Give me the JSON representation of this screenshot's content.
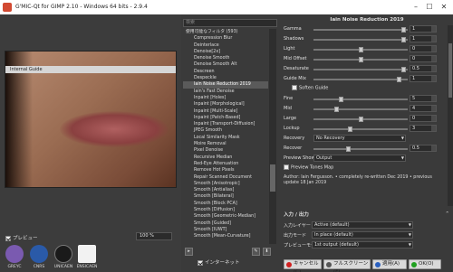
{
  "window": {
    "title": "G'MIC-Qt for GIMP 2.10 - Windows 64 bits - 2.9.4"
  },
  "left": {
    "internal_guide": "Internal Guide",
    "preview_label": "プレビュー",
    "zoom": "100 %",
    "logos": [
      {
        "label": "GREYC",
        "color": "#7a5ab0"
      },
      {
        "label": "CNRS",
        "color": "#2a5aa8"
      },
      {
        "label": "UNICAEN",
        "color": "#1a1a1a"
      },
      {
        "label": "ENSICAEN",
        "color": "#f2f2f2"
      }
    ],
    "settings_label": "設定"
  },
  "mid": {
    "search_placeholder": "検索",
    "items": [
      {
        "label": "使用可能なフィルタ (593)",
        "type": "cat"
      },
      {
        "label": "Compression Blur",
        "type": "item"
      },
      {
        "label": "Deinterlace",
        "type": "item"
      },
      {
        "label": "Denoise[2x]",
        "type": "item"
      },
      {
        "label": "Denoise Smooth",
        "type": "item"
      },
      {
        "label": "Denoise Smooth Alt",
        "type": "item"
      },
      {
        "label": "Descreen",
        "type": "item"
      },
      {
        "label": "Despeckle",
        "type": "item"
      },
      {
        "label": "Iain Noise Reduction 2019",
        "type": "sel"
      },
      {
        "label": "Iain's Fast Denoise",
        "type": "item"
      },
      {
        "label": "Inpaint [Holes]",
        "type": "item"
      },
      {
        "label": "Inpaint [Morphological]",
        "type": "item"
      },
      {
        "label": "Inpaint [Multi-Scale]",
        "type": "item"
      },
      {
        "label": "Inpaint [Patch-Based]",
        "type": "item"
      },
      {
        "label": "Inpaint [Transport-Diffusion]",
        "type": "item"
      },
      {
        "label": "JPEG Smooth",
        "type": "item"
      },
      {
        "label": "Local Similarity Mask",
        "type": "item"
      },
      {
        "label": "Moire Removal",
        "type": "item"
      },
      {
        "label": "Pixel Denoise",
        "type": "item"
      },
      {
        "label": "Recursive Median",
        "type": "item"
      },
      {
        "label": "Red-Eye Attenuation",
        "type": "item"
      },
      {
        "label": "Remove Hot Pixels",
        "type": "item"
      },
      {
        "label": "Repair Scanned Document",
        "type": "item"
      },
      {
        "label": "Smooth [Anisotropic]",
        "type": "item"
      },
      {
        "label": "Smooth [Antialias]",
        "type": "item"
      },
      {
        "label": "Smooth [Bilateral]",
        "type": "item"
      },
      {
        "label": "Smooth [Block PCA]",
        "type": "item"
      },
      {
        "label": "Smooth [Diffusion]",
        "type": "item"
      },
      {
        "label": "Smooth [Geometric-Median]",
        "type": "item"
      },
      {
        "label": "Smooth [Guided]",
        "type": "item"
      },
      {
        "label": "Smooth [IUWT]",
        "type": "item"
      },
      {
        "label": "Smooth [Mean-Curvature]",
        "type": "item"
      }
    ],
    "internet_label": "インターネット"
  },
  "right": {
    "filter_title": "Iain Noise Reduction 2019",
    "params": [
      {
        "kind": "slider",
        "label": "Gamma",
        "value": "1",
        "level": 0.97
      },
      {
        "kind": "slider",
        "label": "Shadows",
        "value": "1",
        "level": 0.97
      },
      {
        "kind": "slider",
        "label": "Light",
        "value": "0",
        "level": 0.5
      },
      {
        "kind": "slider",
        "label": "Mid Offset",
        "value": "0",
        "level": 0.5
      },
      {
        "kind": "slider",
        "label": "Desaturate",
        "value": "0.5",
        "level": 0.97
      },
      {
        "kind": "slider",
        "label": "Guide Mix",
        "value": "1",
        "level": 0.92
      },
      {
        "kind": "check",
        "label": "Soften Guide",
        "checked": false
      },
      {
        "kind": "slider",
        "label": "Fine",
        "value": "5",
        "level": 0.28
      },
      {
        "kind": "slider",
        "label": "Mid",
        "value": "4",
        "level": 0.23
      },
      {
        "kind": "slider",
        "label": "Large",
        "value": "0",
        "level": 0.5
      },
      {
        "kind": "slider",
        "label": "Lockup",
        "value": "3",
        "level": 0.38
      },
      {
        "kind": "drop",
        "label": "Recovery",
        "value": "No Recovery"
      },
      {
        "kind": "slider",
        "label": "Recover",
        "value": "0.5",
        "level": 0.36
      },
      {
        "kind": "drop",
        "label": "Preview Shows",
        "value": "Output"
      },
      {
        "kind": "check",
        "label": "Preview Tones Map",
        "checked": false
      },
      {
        "kind": "text",
        "label": "Author: Iain Fergusson. • completely re-written Dec 2019 • previous update 18 Jan 2019"
      }
    ],
    "io": {
      "title": "入力 / 出力",
      "collapse": "⌃",
      "rows": [
        {
          "label": "入力レイヤー",
          "value": "Active (default)"
        },
        {
          "label": "出力モード",
          "value": "In place (default)"
        },
        {
          "label": "プレビューモード",
          "value": "1st output (default)"
        }
      ]
    },
    "buttons": [
      {
        "label": "キャンセル(C)",
        "icon_color": "#d02020"
      },
      {
        "label": "フルスクリーン(F)",
        "icon_color": "#555555"
      },
      {
        "label": "適用(A)",
        "icon_color": "#2a60c0"
      },
      {
        "label": "OK(O)",
        "icon_color": "#20a020"
      }
    ]
  }
}
